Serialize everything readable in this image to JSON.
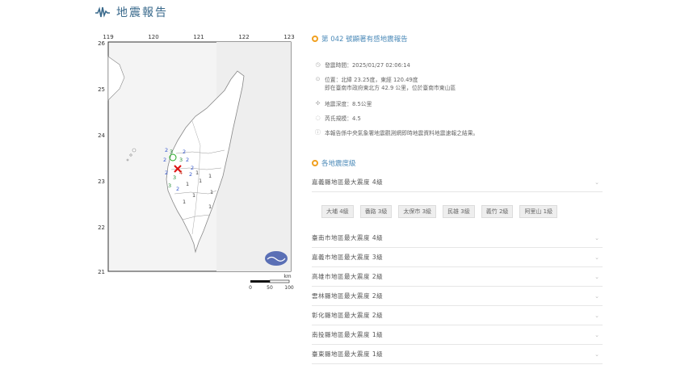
{
  "header": {
    "title": "地震報告"
  },
  "map": {
    "lon_ticks": [
      "119",
      "120",
      "121",
      "122",
      "123"
    ],
    "lat_ticks": [
      "26",
      "25",
      "24",
      "23",
      "22",
      "21"
    ],
    "scale": {
      "labels": [
        "0",
        "50",
        "100"
      ],
      "unit": "km"
    },
    "intensity_marks": [
      "2",
      "2",
      "3",
      "2",
      "3",
      "2",
      "4",
      "3",
      "2",
      "2",
      "3",
      "2",
      "1",
      "1",
      "2",
      "1",
      "1",
      "1",
      "1",
      "1",
      "1"
    ]
  },
  "report": {
    "title": "第 042 號顯著有感地震報告",
    "time": "發震時間：2025/01/27 02:06:14",
    "location_line1": "位置：北緯 23.25度，東經 120.49度",
    "location_line2": "即在臺南市政府東北方 42.9 公里，位於臺南市東山區",
    "depth": "地震深度：8.5公里",
    "magnitude": "芮氏規模：4.5",
    "note": "本報告係中央氣象署地震觀測網即時地震資料地震速報之結果。"
  },
  "intensity_section": {
    "title": "各地震度級",
    "regions": [
      {
        "label": "嘉義縣地區最大震度 4級"
      },
      {
        "label": "臺南市地區最大震度 4級"
      },
      {
        "label": "嘉義市地區最大震度 3級"
      },
      {
        "label": "高雄市地區最大震度 2級"
      },
      {
        "label": "雲林縣地區最大震度 2級"
      },
      {
        "label": "彰化縣地區最大震度 2級"
      },
      {
        "label": "南投縣地區最大震度 1級"
      },
      {
        "label": "臺東縣地區最大震度 1級"
      }
    ],
    "chips": [
      "大埔 4級",
      "番路 3級",
      "太保市 3級",
      "民雄 3級",
      "義竹 2級",
      "阿里山 1級"
    ]
  }
}
